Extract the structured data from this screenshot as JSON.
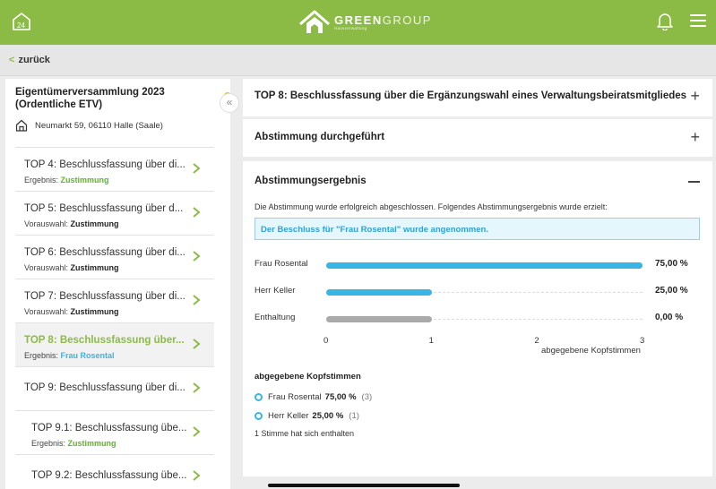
{
  "header": {
    "home_label": "24",
    "brand_main": "GREEN",
    "brand_light": "GROUP",
    "brand_sub": "Hausverwaltung",
    "colors": {
      "topbar": "#8cbb45",
      "accent_blue": "#39b4e5",
      "bar_gray": "#aaaaaa"
    }
  },
  "nav": {
    "back_label": "zurück"
  },
  "sidebar": {
    "title": "Eigentümerversammlung 2023 (Ordentliche ETV)",
    "address": "Neumarkt 59, 06110 Halle (Saale)",
    "collapse_icon": "«",
    "items": [
      {
        "title": "TOP 4: Beschlussfassung über di...",
        "result_label": "Ergebnis:",
        "result_value": "Zustimmung"
      },
      {
        "title": "TOP 5: Beschlussfassung über d...",
        "result_label": "Vorauswahl:",
        "result_value": "Zustimmung"
      },
      {
        "title": "TOP 6: Beschlussfassung über di...",
        "result_label": "Vorauswahl:",
        "result_value": "Zustimmung"
      },
      {
        "title": "TOP 7: Beschlussfassung über di...",
        "result_label": "Vorauswahl:",
        "result_value": "Zustimmung"
      },
      {
        "title": "TOP 8: Beschlussfassung über...",
        "result_label": "Ergebnis:",
        "result_value": "Frau Rosental"
      },
      {
        "title": "TOP 9: Beschlussfassung über di..."
      },
      {
        "title": "TOP 9.1: Beschlussfassung übe...",
        "result_label": "Ergebnis:",
        "result_value": "Zustimmung"
      },
      {
        "title": "TOP 9.2: Beschlussfassung übe..."
      }
    ]
  },
  "main": {
    "top_header": "TOP 8: Beschlussfassung über die Ergänzungswahl eines Verwaltungsbeiratsmitgliedes",
    "voting_done": "Abstimmung durchgeführt",
    "result_title": "Abstimmungsergebnis",
    "result_desc": "Die Abstimmung wurde erfolgreich abgeschlossen. Folgendes Abstimmungsergebnis wurde erzielt:",
    "result_alert": "Der Beschluss für \"Frau Rosental\" wurde angenommen.",
    "votes_heading": "abgegebene Kopfstimmen",
    "votes": [
      {
        "name": "Frau Rosental",
        "pct": "75,00 %",
        "count": "(3)"
      },
      {
        "name": "Herr Keller",
        "pct": "25,00 %",
        "count": "(1)"
      }
    ],
    "abstained": "1 Stimme hat sich enthalten"
  },
  "chart_data": {
    "type": "bar",
    "orientation": "horizontal",
    "categories": [
      "Frau Rosental",
      "Herr Keller",
      "Enthaltung"
    ],
    "values": [
      3,
      1,
      1
    ],
    "value_labels": [
      "75,00 %",
      "25,00 %",
      "0,00 %"
    ],
    "colors": [
      "#39b4e5",
      "#39b4e5",
      "#aaaaaa"
    ],
    "xlim": [
      0,
      3
    ],
    "xticks": [
      "0",
      "1",
      "2",
      "3"
    ],
    "xlabel": "abgegebene Kopfstimmen"
  }
}
